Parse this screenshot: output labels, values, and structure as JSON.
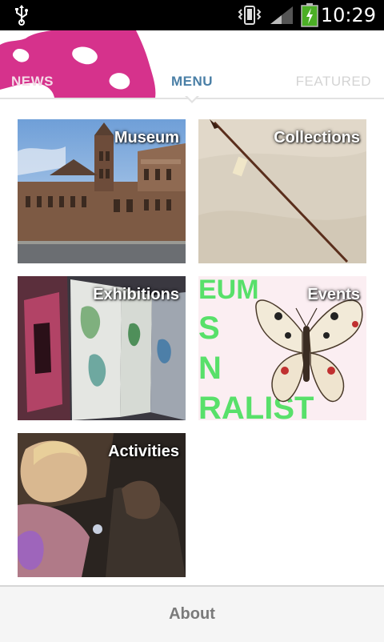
{
  "status_bar": {
    "time": "10:29",
    "icons": [
      "usb-icon",
      "vibrate-icon",
      "signal-icon",
      "battery-charging-icon"
    ]
  },
  "tabs": [
    {
      "label": "NEWS",
      "active": false
    },
    {
      "label": "MENU",
      "active": true
    },
    {
      "label": "FEATURED",
      "active": false
    }
  ],
  "menu": {
    "items": [
      {
        "label": "Museum"
      },
      {
        "label": "Collections"
      },
      {
        "label": "Exhibitions"
      },
      {
        "label": "Events"
      },
      {
        "label": "Activities"
      }
    ]
  },
  "events_poster_text": [
    "EUM",
    "S",
    "N",
    "RALIST"
  ],
  "about": {
    "label": "About"
  },
  "colors": {
    "accent_magenta": "#d6328c",
    "active_tab": "#4a7fa6",
    "inactive_tab": "#d4d4d4",
    "poster_green": "#58e06a"
  }
}
